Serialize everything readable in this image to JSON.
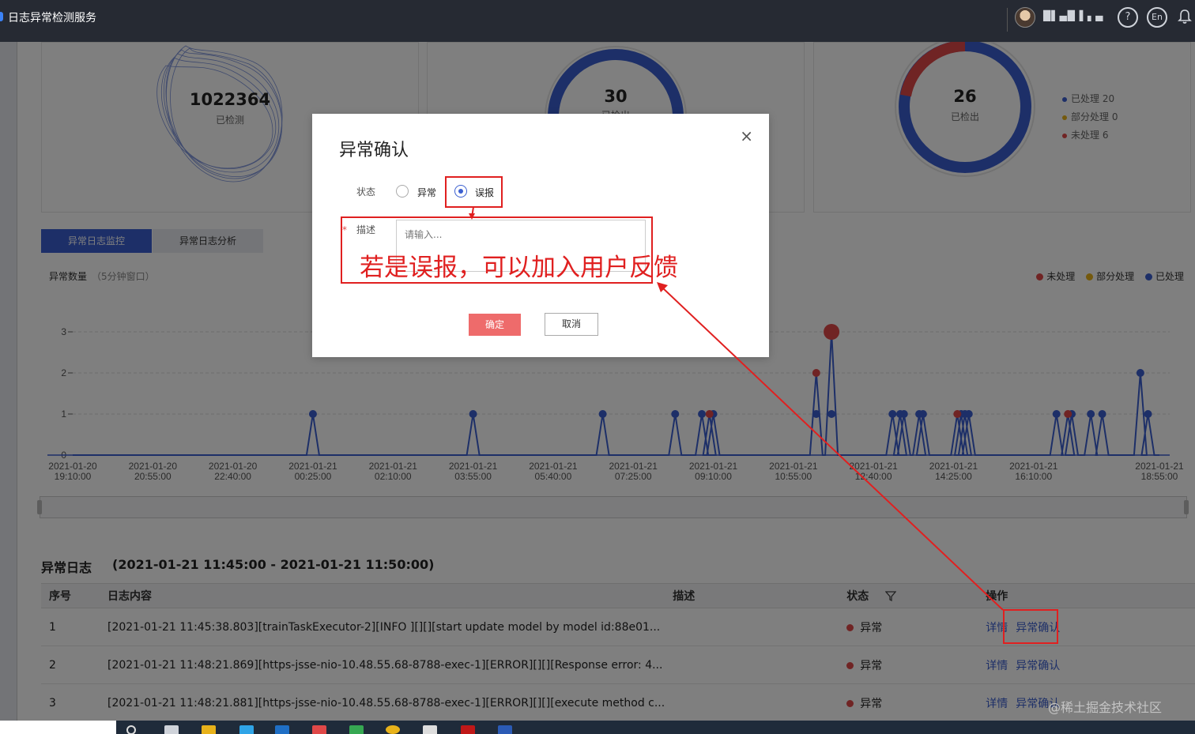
{
  "topbar": {
    "app_title": "日志异常检测服务",
    "username": "█▌▄█ ▌▖▄",
    "help_label": "?",
    "lang_label": "En"
  },
  "summary": {
    "card1": {
      "value": "1022364",
      "label": "已检测"
    },
    "card2": {
      "value": "30",
      "label": "已检出"
    },
    "card3": {
      "value": "26",
      "label": "已检出",
      "legend": [
        {
          "label": "已处理 20",
          "color": "#3b5fd0"
        },
        {
          "label": "部分处理 0",
          "color": "#e8b21a"
        },
        {
          "label": "未处理 6",
          "color": "#e04848"
        }
      ]
    }
  },
  "tabs": [
    "异常日志监控",
    "异常日志分析"
  ],
  "chart_header": {
    "title": "异常数量",
    "subtitle": "（5分钟窗口）",
    "legend": [
      {
        "label": "未处理",
        "color": "#e04848"
      },
      {
        "label": "部分处理",
        "color": "#e8b21a"
      },
      {
        "label": "已处理",
        "color": "#3b5fd0"
      }
    ]
  },
  "chart_data": {
    "type": "line",
    "title": "",
    "xlabel": "",
    "ylabel": "",
    "ylim": [
      0,
      3
    ],
    "y_ticks": [
      "0",
      "1",
      "2",
      "3"
    ],
    "x_ticks": [
      {
        "date": "2021-01-20",
        "time": "19:10:00"
      },
      {
        "date": "2021-01-20",
        "time": "20:55:00"
      },
      {
        "date": "2021-01-20",
        "time": "22:40:00"
      },
      {
        "date": "2021-01-21",
        "time": "00:25:00"
      },
      {
        "date": "2021-01-21",
        "time": "02:10:00"
      },
      {
        "date": "2021-01-21",
        "time": "03:55:00"
      },
      {
        "date": "2021-01-21",
        "time": "05:40:00"
      },
      {
        "date": "2021-01-21",
        "time": "07:25:00"
      },
      {
        "date": "2021-01-21",
        "time": "09:10:00"
      },
      {
        "date": "2021-01-21",
        "time": "10:55:00"
      },
      {
        "date": "2021-01-21",
        "time": "12:40:00"
      },
      {
        "date": "2021-01-21",
        "time": "14:25:00"
      },
      {
        "date": "2021-01-21",
        "time": "16:10:00"
      },
      {
        "date": "2021-01-21",
        "time": "18:55:00"
      }
    ],
    "series": [
      {
        "name": "已处理",
        "color": "#3b5fd0",
        "points": [
          {
            "x": "2021-01-21 00:25",
            "y": 1
          },
          {
            "x": "2021-01-21 03:55",
            "y": 1
          },
          {
            "x": "2021-01-21 06:45",
            "y": 1
          },
          {
            "x": "2021-01-21 08:20",
            "y": 1
          },
          {
            "x": "2021-01-21 08:55",
            "y": 1
          },
          {
            "x": "2021-01-21 09:10",
            "y": 1
          },
          {
            "x": "2021-01-21 11:25",
            "y": 1
          },
          {
            "x": "2021-01-21 11:45",
            "y": 1
          },
          {
            "x": "2021-01-21 13:05",
            "y": 1
          },
          {
            "x": "2021-01-21 13:15",
            "y": 1
          },
          {
            "x": "2021-01-21 13:20",
            "y": 1
          },
          {
            "x": "2021-01-21 13:40",
            "y": 1
          },
          {
            "x": "2021-01-21 13:45",
            "y": 1
          },
          {
            "x": "2021-01-21 14:35",
            "y": 1
          },
          {
            "x": "2021-01-21 14:40",
            "y": 1
          },
          {
            "x": "2021-01-21 14:45",
            "y": 1
          },
          {
            "x": "2021-01-21 16:40",
            "y": 1
          },
          {
            "x": "2021-01-21 17:00",
            "y": 1
          },
          {
            "x": "2021-01-21 17:25",
            "y": 1
          },
          {
            "x": "2021-01-21 17:40",
            "y": 1
          },
          {
            "x": "2021-01-21 18:30",
            "y": 2
          },
          {
            "x": "2021-01-21 18:40",
            "y": 1
          }
        ]
      },
      {
        "name": "未处理",
        "color": "#e04848",
        "points": [
          {
            "x": "2021-01-21 09:05",
            "y": 1
          },
          {
            "x": "2021-01-21 11:25",
            "y": 2
          },
          {
            "x": "2021-01-21 11:45",
            "y": 3
          },
          {
            "x": "2021-01-21 14:30",
            "y": 1
          },
          {
            "x": "2021-01-21 16:55",
            "y": 1
          }
        ]
      }
    ]
  },
  "log_section": {
    "title": "异常日志",
    "range": "(2021-01-21 11:45:00 - 2021-01-21 11:50:00)",
    "columns": [
      "序号",
      "日志内容",
      "描述",
      "状态",
      "操作"
    ],
    "rows": [
      {
        "no": "1",
        "content": "[2021-01-21 11:45:38.803][trainTaskExecutor-2][INFO ][][][start update model by model id:88e01...",
        "desc": "",
        "status": "异常",
        "op1": "详情",
        "op2": "异常确认"
      },
      {
        "no": "2",
        "content": "[2021-01-21 11:48:21.869][https-jsse-nio-10.48.55.68-8788-exec-1][ERROR][][][Response error: 4...",
        "desc": "",
        "status": "异常",
        "op1": "详情",
        "op2": "异常确认"
      },
      {
        "no": "3",
        "content": "[2021-01-21 11:48:21.881][https-jsse-nio-10.48.55.68-8788-exec-1][ERROR][][][execute method c...",
        "desc": "",
        "status": "异常",
        "op1": "详情",
        "op2": "异常确认"
      }
    ]
  },
  "modal": {
    "title": "异常确认",
    "close": "×",
    "status_label": "状态",
    "options": [
      "异常",
      "误报"
    ],
    "selected": "误报",
    "desc_label": "描述",
    "required_mark": "*",
    "desc_placeholder": "请输入...",
    "ok": "确定",
    "cancel": "取消"
  },
  "annotation": {
    "text": "若是误报，可以加入用户反馈",
    "color": "#e02020"
  },
  "watermark": "@稀土掘金技术社区"
}
